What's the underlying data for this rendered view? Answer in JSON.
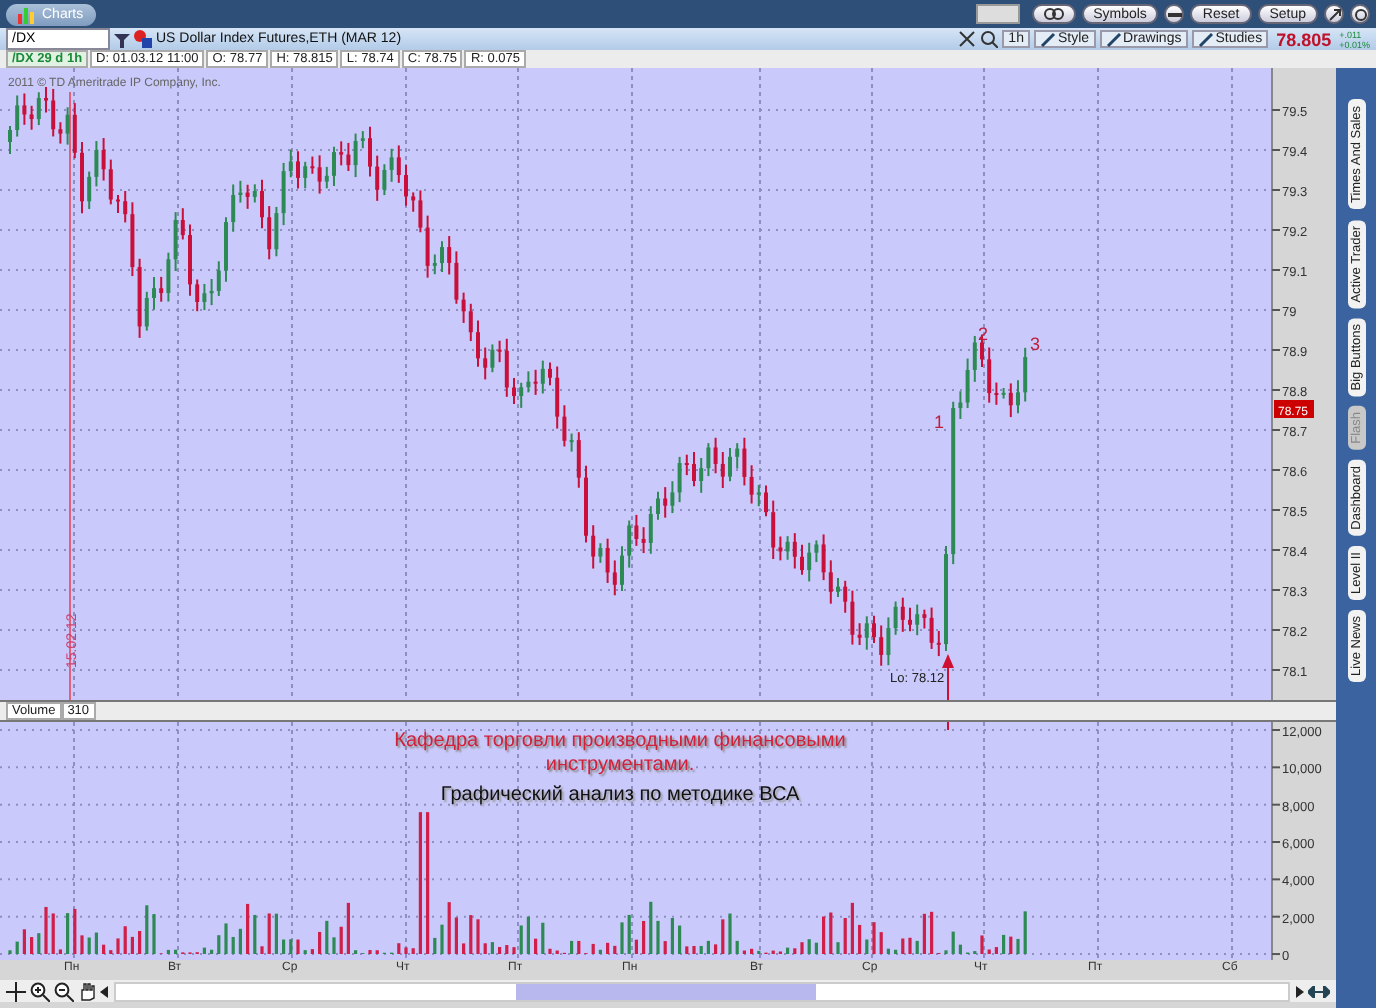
{
  "window": {
    "title": "Charts"
  },
  "header_buttons": [
    "Symbols",
    "Reset",
    "Setup"
  ],
  "toolbar": {
    "symbol": "/DX",
    "description": "US Dollar Index Futures,ETH (MAR 12)",
    "timeframe": "1h",
    "buttons": [
      "Style",
      "Drawings",
      "Studies"
    ],
    "last_price": "78.805",
    "change": "+.011",
    "change_pct": "+0.01%"
  },
  "info_bar": [
    "/DX 29 d 1h",
    "D: 01.03.12 11:00",
    "O: 78.77",
    "H: 78.815",
    "L: 78.74",
    "C: 78.75",
    "R: 0.075"
  ],
  "price_chart": {
    "copyright": "2011 © TD Ameritrade IP Company, Inc.",
    "marker_date": "15.02.12",
    "axis_labels": [
      "79.5",
      "79.4",
      "79.3",
      "79.2",
      "79.1",
      "79",
      "78.9",
      "78.8",
      "78.7",
      "78.6",
      "78.5",
      "78.4",
      "78.3",
      "78.2",
      "78.1"
    ],
    "price_tag": "78.75",
    "annotations": [
      "1",
      "2",
      "3"
    ],
    "low_label": "Lo: 78.12"
  },
  "volume": {
    "label": "Volume",
    "value": "310",
    "axis_labels": [
      "12,000",
      "10,000",
      "8,000",
      "6,000",
      "4,000",
      "2,000",
      "0"
    ],
    "overlay": [
      {
        "kind": "title",
        "text": "Кафедра торговли производными финансовыми инструментами."
      },
      {
        "kind": "subtitle",
        "text": "Графический анализ по методике ВСА"
      }
    ]
  },
  "x_axis": [
    "Пн",
    "Вт",
    "Ср",
    "Чт",
    "Пт",
    "Пн",
    "Вт",
    "Ср",
    "Чт",
    "Пт",
    "Сб"
  ],
  "sidebar_tabs": [
    {
      "label": "Times And Sales",
      "disabled": false
    },
    {
      "label": "Active Trader",
      "disabled": false
    },
    {
      "label": "Big Buttons",
      "disabled": false
    },
    {
      "label": "Flash",
      "disabled": true
    },
    {
      "label": "Dashboard",
      "disabled": false
    },
    {
      "label": "Level II",
      "disabled": false
    },
    {
      "label": "Live News",
      "disabled": false
    }
  ]
}
